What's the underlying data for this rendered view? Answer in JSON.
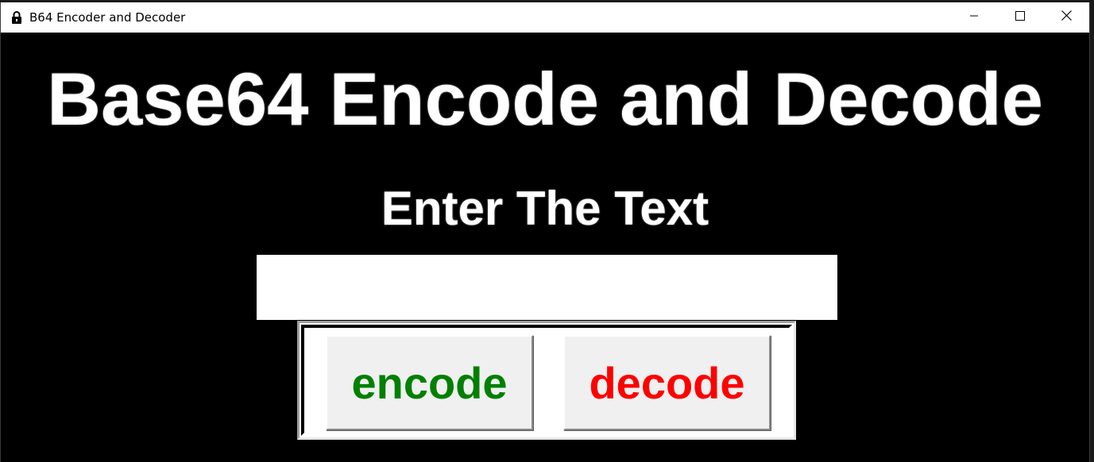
{
  "window": {
    "title": "B64 Encoder and Decoder",
    "icon": "lock-icon"
  },
  "controls": {
    "minimize_icon": "minimize-icon",
    "maximize_icon": "maximize-icon",
    "close_icon": "close-icon"
  },
  "main": {
    "heading": "Base64 Encode and Decode",
    "subheading": "Enter The Text",
    "input_value": "",
    "encode_label": "encode",
    "decode_label": "decode"
  },
  "colors": {
    "background": "#000000",
    "text": "#ffffff",
    "encode": "#008000",
    "decode": "#ff0000",
    "button_face": "#f0f0f0"
  }
}
